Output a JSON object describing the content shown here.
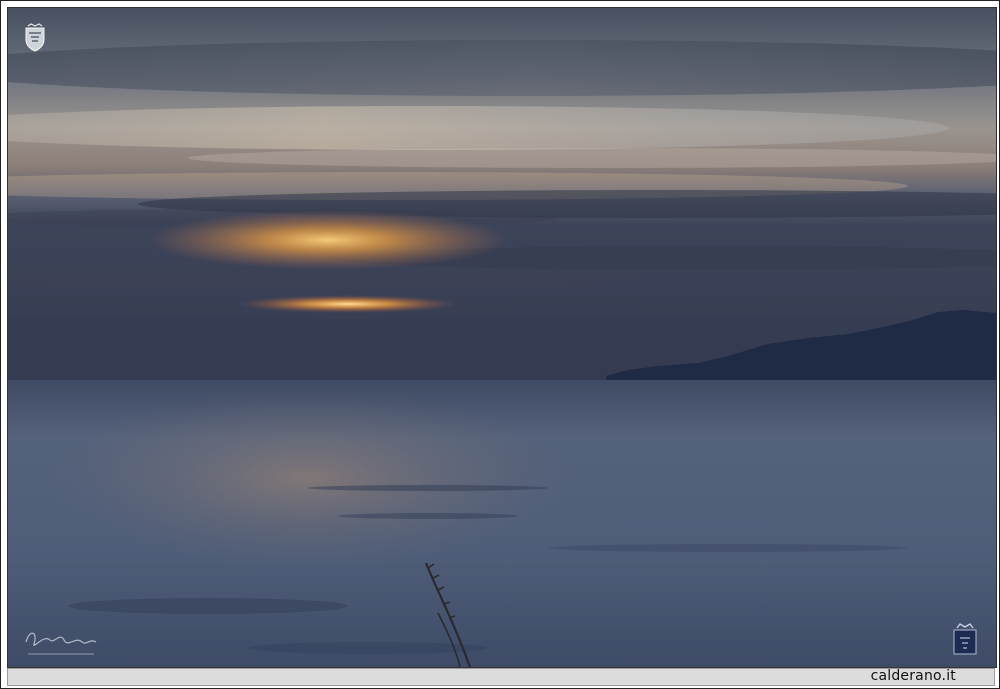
{
  "caption": {
    "site_label": "calderano.it"
  },
  "colors": {
    "sky_top": "#4a5566",
    "sky_mid": "#8e8a86",
    "sun_glow": "#f3b24a",
    "horizon_haze": "#3c4358",
    "sea": "#4b5a74",
    "land": "#1f2b45"
  },
  "icons": {
    "top_left": "crest-icon",
    "bottom_right": "crest-icon",
    "bottom_left": "signature"
  }
}
